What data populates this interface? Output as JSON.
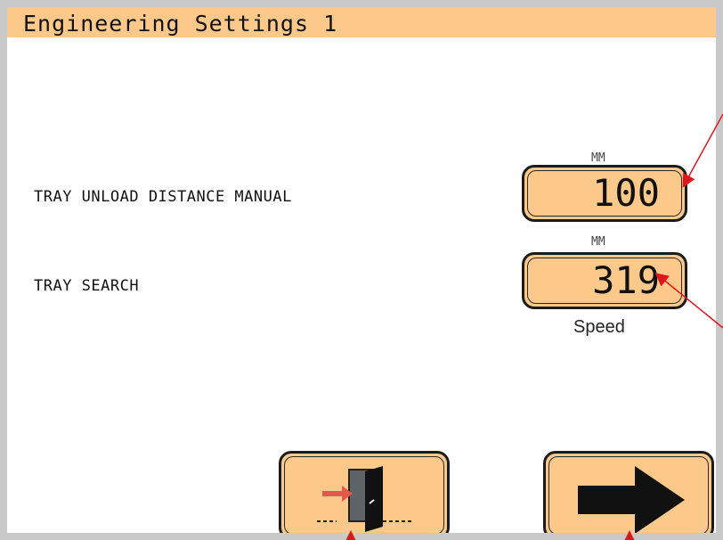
{
  "window": {
    "title": "Engineering Settings 1"
  },
  "settings": [
    {
      "label": "TRAY UNLOAD DISTANCE MANUAL",
      "unit": "MM",
      "value": "100"
    },
    {
      "label": "TRAY SEARCH",
      "unit": "MM",
      "value": "319",
      "sublabel": "Speed"
    }
  ],
  "buttons": {
    "exit": {
      "icon": "exit-door-icon"
    },
    "next": {
      "icon": "right-arrow-icon"
    }
  },
  "colors": {
    "panel": "#fcc98b",
    "border": "#1b1b1b",
    "callout": "#e0161e",
    "bezel": "#c9c9c9"
  }
}
